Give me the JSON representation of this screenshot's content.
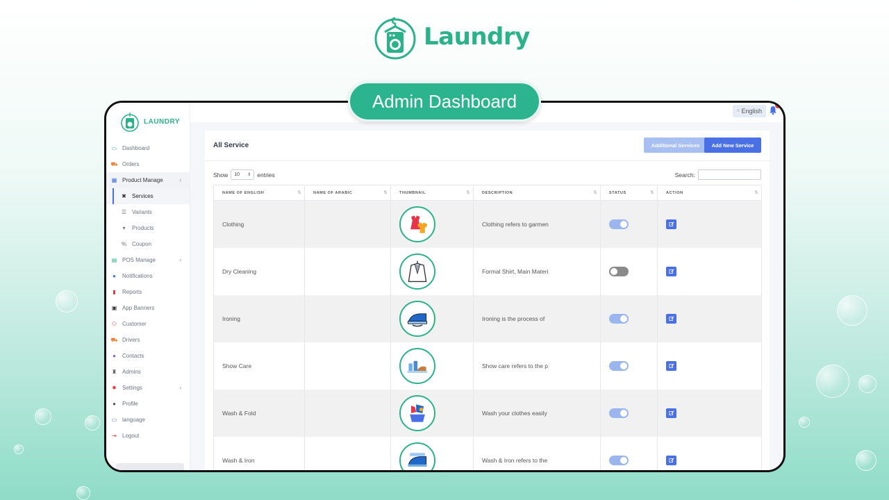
{
  "brand": {
    "name": "Laundry"
  },
  "banner": {
    "label": "Admin Dashboard"
  },
  "sidebar": {
    "logo_text": "LAUNDRY",
    "items": [
      {
        "label": "Dashboard",
        "icon": "monitor-icon"
      },
      {
        "label": "Orders",
        "icon": "cart-icon"
      },
      {
        "label": "Product Manage",
        "icon": "grid-icon"
      },
      {
        "label": "Services",
        "icon": "tools-icon"
      },
      {
        "label": "Variants",
        "icon": "list-icon"
      },
      {
        "label": "Products",
        "icon": "shirt-icon"
      },
      {
        "label": "Coupon",
        "icon": "percent-icon"
      },
      {
        "label": "POS Manage",
        "icon": "store-icon"
      },
      {
        "label": "Notifications",
        "icon": "bell-icon"
      },
      {
        "label": "Reports",
        "icon": "file-icon"
      },
      {
        "label": "App Banners",
        "icon": "image-icon"
      },
      {
        "label": "Customer",
        "icon": "users-icon"
      },
      {
        "label": "Drivers",
        "icon": "truck-icon"
      },
      {
        "label": "Contacts",
        "icon": "chat-icon"
      },
      {
        "label": "Admins",
        "icon": "admin-icon"
      },
      {
        "label": "Settings",
        "icon": "gear-icon"
      },
      {
        "label": "Profile",
        "icon": "user-icon"
      },
      {
        "label": "language",
        "icon": "language-icon"
      },
      {
        "label": "Logout",
        "icon": "logout-icon"
      }
    ]
  },
  "topbar": {
    "language": "English"
  },
  "card": {
    "title": "All Service",
    "additional_label": "Additional Services",
    "add_label": "Add New Service",
    "show_label": "Show",
    "entries_value": "10",
    "entries_label": "entries",
    "search_label": "Search:"
  },
  "table": {
    "headers": [
      "NAME OF ENGLISH",
      "NAME OF ARABIC",
      "THUMBNAIL",
      "DESCRIPTION",
      "STATUS",
      "ACTION"
    ],
    "rows": [
      {
        "name_en": "Clothing",
        "name_ar": "",
        "description": "Clothing refers to garmen",
        "status": true,
        "thumb": "clothing"
      },
      {
        "name_en": "Dry Cleaning",
        "name_ar": "",
        "description": "Formal Shirt, Main Materi",
        "status": false,
        "thumb": "dry-cleaning"
      },
      {
        "name_en": "Ironing",
        "name_ar": "",
        "description": "Ironing is the process of",
        "status": true,
        "thumb": "ironing"
      },
      {
        "name_en": "Show Care",
        "name_ar": "",
        "description": "Show care refers to the p",
        "status": true,
        "thumb": "shoe-care"
      },
      {
        "name_en": "Wash & Fold",
        "name_ar": "",
        "description": "Wash your clothes easily",
        "status": true,
        "thumb": "wash-fold"
      },
      {
        "name_en": "Wash & Iron",
        "name_ar": "",
        "description": "Wash & Iron refers to the",
        "status": true,
        "thumb": "wash-iron"
      }
    ]
  },
  "colors": {
    "brand_green": "#2bb28a",
    "primary_blue": "#4a70e6",
    "light_blue": "#a7bff3"
  }
}
